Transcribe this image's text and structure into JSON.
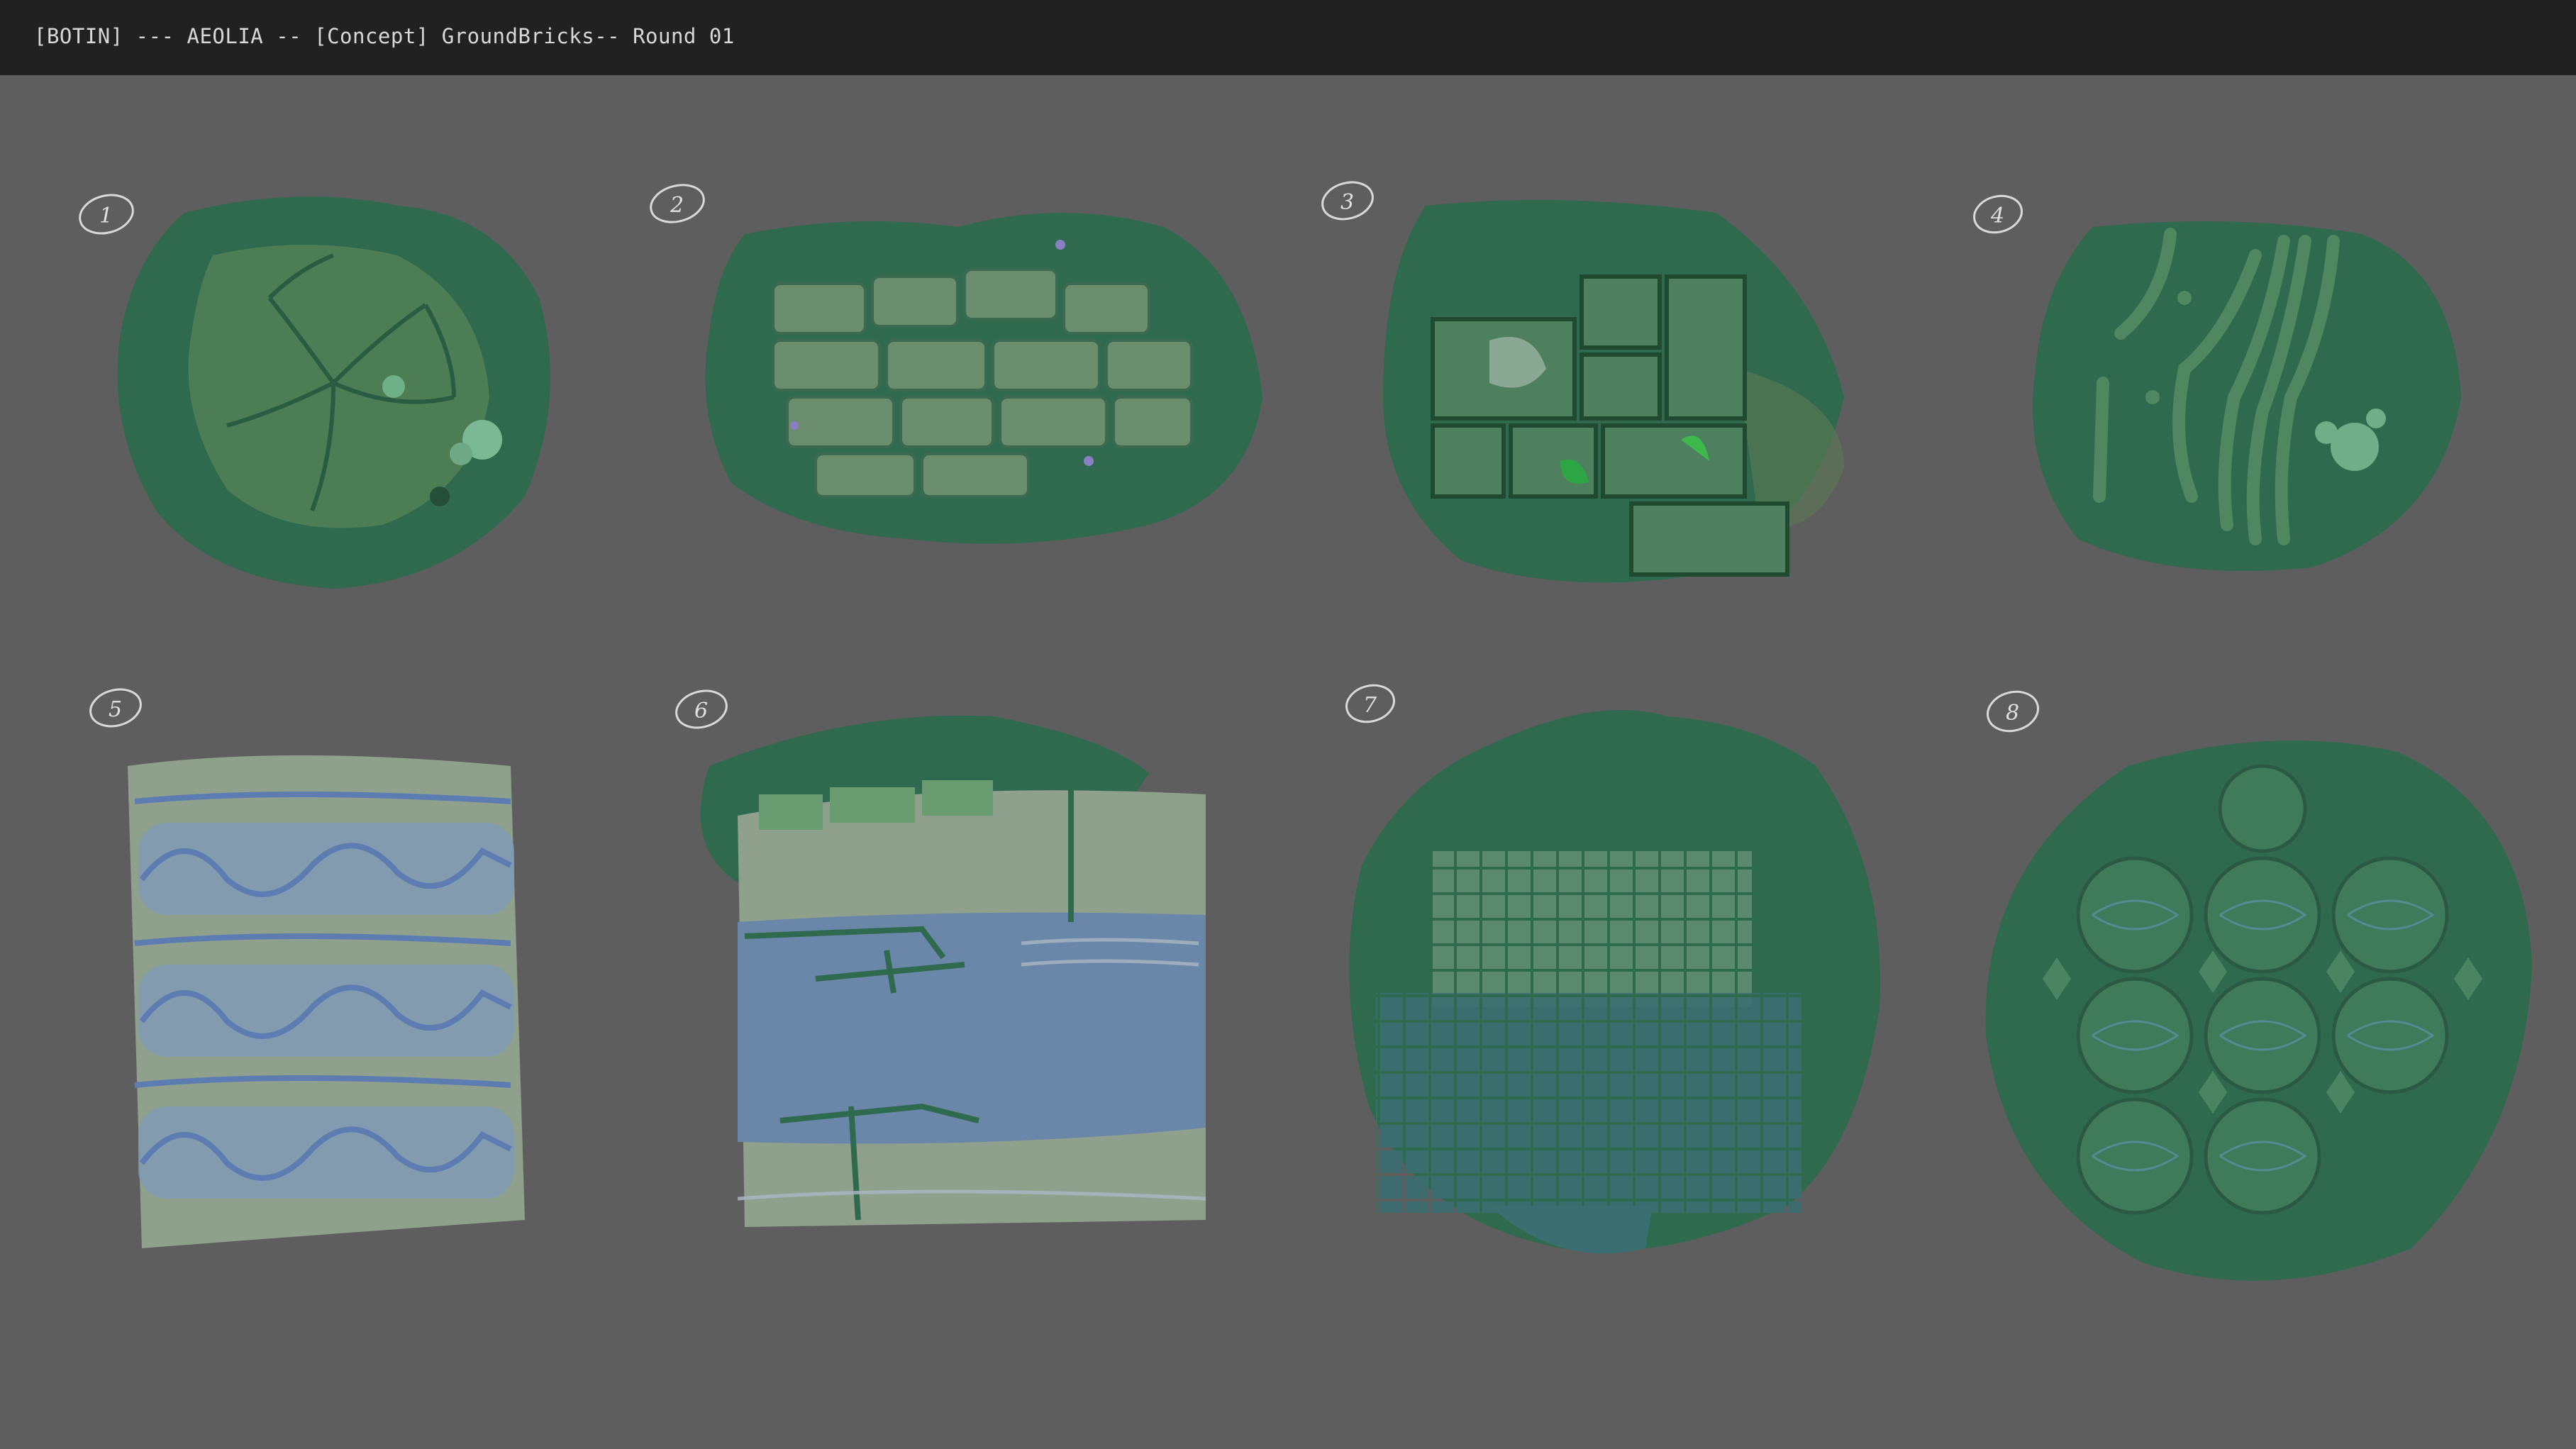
{
  "window": {
    "title": "[BOTIN] --- AEOLIA -- [Concept] GroundBricks-- Round 01"
  },
  "concepts": [
    {
      "number": "1",
      "color": "#2f6a4e"
    },
    {
      "number": "2",
      "color": "#2f6a4e"
    },
    {
      "number": "3",
      "color": "#2c6a44"
    },
    {
      "number": "4",
      "color": "#2f6a4e"
    },
    {
      "number": "5",
      "color": "#8fa08c"
    },
    {
      "number": "6",
      "color": "#6a86a8"
    },
    {
      "number": "7",
      "color": "#2f6a4e"
    },
    {
      "number": "8",
      "color": "#2f6a4e"
    }
  ]
}
